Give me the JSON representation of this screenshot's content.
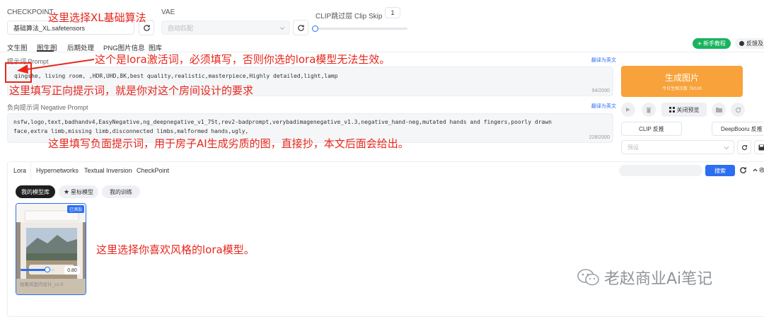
{
  "top": {
    "checkpoint_label": "CHECKPOINT",
    "checkpoint_value": "基础算法_XL.safetensors",
    "vae_label": "VAE",
    "vae_value": "自动匹配",
    "clip_label": "CLIP跳过层 Clip Skip",
    "clip_value": "1"
  },
  "tabs": [
    "文生图",
    "图生图",
    "后期处理",
    "PNG图片信息",
    "图库"
  ],
  "top_right": {
    "tutorial": "新手教程",
    "feedback": "反馈及"
  },
  "prompt": {
    "label": "提示词 Prompt",
    "translate": "翻译为英文",
    "text": "qingshe, living room, ,HDR,UHD,8K,best quality,realistic,masterpiece,Highly detailed,light,lamp",
    "count": "94/2000"
  },
  "negative": {
    "label": "负向提示词 Negative Prompt",
    "translate": "翻译为英文",
    "text": "nsfw,logo,text,badhandv4,EasyNegative,ng_deepnegative_v1_75t,rev2-badprompt,verybadimagenegative_v1.3,negative_hand-neg,mutated hands and fingers,poorly drawn face,extra limb,missing limb,disconnected limbs,malformed hands,ugly,",
    "count": "228/2000"
  },
  "generate": {
    "label": "生成图片",
    "sub": "今日生图次数 78/100"
  },
  "actions": {
    "close_preview": "关闭预览",
    "clip_interrogate": "CLIP 反推",
    "deepbooru": "DeepBooru 反推",
    "preset_placeholder": "预设"
  },
  "lora_tabs": [
    "Lora",
    "Hypernetworks",
    "Textual Inversion",
    "CheckPoint"
  ],
  "search_button": "搜索",
  "collapse_label": "收",
  "model_filters": [
    "我的模型库",
    "星标模型",
    "我的训练"
  ],
  "card": {
    "badge": "已添加",
    "weight": "0.80",
    "weight_fraction": 0.8,
    "name": "轻奢风室内设计_v1.0"
  },
  "annotations": {
    "xl": "这里选择XL基础算法",
    "lora_word": "这个是lora激活词，必须填写，否则你选的lora模型无法生效。",
    "positive": "这里填写正向提示词，就是你对这个房间设计的要求",
    "negative": "这里填写负面提示词，用于房子AI生成劣质的图，直接抄，本文后面会给出。",
    "lora_model": "这里选择你喜欢风格的lora模型。"
  },
  "watermark": "老赵商业Ai笔记",
  "colors": {
    "primary": "#2b6ef2",
    "orange": "#f7a23a",
    "green": "#19b35e",
    "red": "#e8261c"
  }
}
